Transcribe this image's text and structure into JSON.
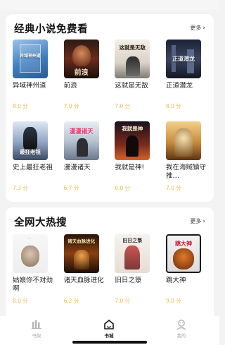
{
  "sections": [
    {
      "title": "经典小说免费看",
      "more": "更多",
      "books": [
        {
          "name": "异域神州道",
          "score": "8.0 分",
          "cover_text": "异域神州道"
        },
        {
          "name": "前浪",
          "score": "7.0 分",
          "cover_text": "前浪"
        },
        {
          "name": "这就是无敌",
          "score": "7.0 分",
          "cover_text": "这就是无敌"
        },
        {
          "name": "正道潜龙",
          "score": "8.0 分",
          "cover_text": "正道潜龙"
        },
        {
          "name": "史上最狂老祖",
          "score": "7.3 分",
          "cover_text": "最狂老祖"
        },
        {
          "name": "漫漫诸天",
          "score": "6.7 分",
          "cover_text": "漫漫诸天"
        },
        {
          "name": "我就是神!",
          "score": "0.0 分",
          "cover_text": "我就是神"
        },
        {
          "name": "我在海贼镇守推…",
          "score": "7.0 分",
          "cover_text": ""
        }
      ]
    },
    {
      "title": "全网大热搜",
      "more": "更多",
      "books": [
        {
          "name": "姑娘你不对劲啊",
          "score": "8.0 分",
          "cover_text": ""
        },
        {
          "name": "诸天血脉进化",
          "score": "6.2 分",
          "cover_text": "诸天血脉进化"
        },
        {
          "name": "旧日之箓",
          "score": "7.0 分",
          "cover_text": "旧日之箓"
        },
        {
          "name": "跳大神",
          "score": "9.0 分",
          "cover_text": "跳大神"
        }
      ]
    }
  ],
  "tabs": [
    {
      "label": "书架",
      "icon": "bookshelf-icon"
    },
    {
      "label": "书城",
      "icon": "bookstore-icon",
      "active": true
    },
    {
      "label": "我的",
      "icon": "profile-icon"
    }
  ],
  "colors": {
    "score": "#f0b84b",
    "background": "#f3f3f3"
  }
}
